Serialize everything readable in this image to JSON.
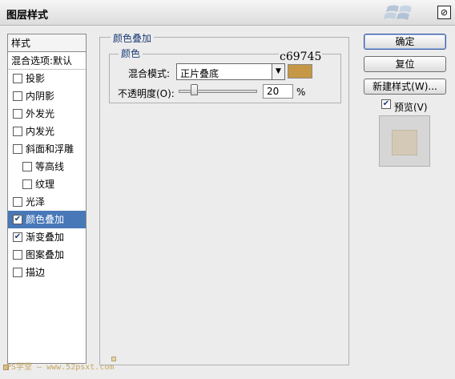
{
  "window": {
    "title": "图层样式",
    "close_glyph": "⊘"
  },
  "style_list": {
    "header": "样式",
    "blend_options": "混合选项:默认",
    "items": [
      {
        "label": "投影",
        "checked": false,
        "sub": false
      },
      {
        "label": "内阴影",
        "checked": false,
        "sub": false
      },
      {
        "label": "外发光",
        "checked": false,
        "sub": false
      },
      {
        "label": "内发光",
        "checked": false,
        "sub": false
      },
      {
        "label": "斜面和浮雕",
        "checked": false,
        "sub": false
      },
      {
        "label": "等高线",
        "checked": false,
        "sub": true
      },
      {
        "label": "纹理",
        "checked": false,
        "sub": true
      },
      {
        "label": "光泽",
        "checked": false,
        "sub": false
      },
      {
        "label": "颜色叠加",
        "checked": true,
        "sub": false,
        "selected": true
      },
      {
        "label": "渐变叠加",
        "checked": true,
        "sub": false
      },
      {
        "label": "图案叠加",
        "checked": false,
        "sub": false
      },
      {
        "label": "描边",
        "checked": false,
        "sub": false
      }
    ]
  },
  "panel": {
    "group_title": "颜色叠加",
    "sub_title": "颜色",
    "color_hex_label": "c69745",
    "blend_mode_label": "混合模式:",
    "blend_mode_value": "正片叠底",
    "swatch_color": "#c69745",
    "opacity_label": "不透明度(O):",
    "opacity_value": "20",
    "opacity_unit": "%",
    "opacity_fraction": 0.2
  },
  "buttons": {
    "ok": "确定",
    "reset": "复位",
    "new_style": "新建样式(W)...",
    "preview_label": "预览(V)",
    "preview_checked": true
  },
  "watermark": "PS学堂 — www.52psxt.com",
  "colors": {
    "selection": "#4878b8",
    "accent": "#1c3c78"
  }
}
